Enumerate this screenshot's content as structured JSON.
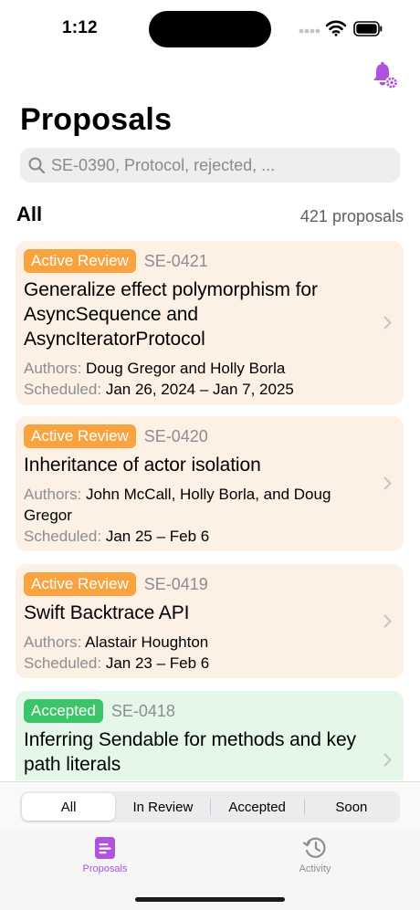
{
  "status": {
    "time": "1:12"
  },
  "header": {
    "title": "Proposals"
  },
  "search": {
    "placeholder": "SE-0390, Protocol, rejected, ..."
  },
  "section": {
    "title": "All",
    "count": "421 proposals"
  },
  "labels": {
    "authors": "Authors:",
    "scheduled": "Scheduled:"
  },
  "proposals": [
    {
      "status": "Active Review",
      "id": "SE-0421",
      "title": "Generalize effect polymorphism for AsyncSequence and AsyncIteratorProtocol",
      "authors": "Doug Gregor and Holly Borla",
      "scheduled": "Jan 26, 2024 – Jan 7, 2025"
    },
    {
      "status": "Active Review",
      "id": "SE-0420",
      "title": "Inheritance of actor isolation",
      "authors": "John McCall, Holly Borla, and Doug Gregor",
      "scheduled": "Jan 25 – Feb 6"
    },
    {
      "status": "Active Review",
      "id": "SE-0419",
      "title": "Swift Backtrace API",
      "authors": "Alastair Houghton",
      "scheduled": "Jan 23 – Feb 6"
    },
    {
      "status": "Accepted",
      "id": "SE-0418",
      "title": "Inferring Sendable for methods and key path literals"
    }
  ],
  "filter": {
    "options": [
      "All",
      "In Review",
      "Accepted",
      "Soon"
    ],
    "selected": "All"
  },
  "tabs": [
    {
      "label": "Proposals",
      "icon": "doc-text-icon",
      "active": true
    },
    {
      "label": "Activity",
      "icon": "clock-history-icon",
      "active": false
    }
  ],
  "colors": {
    "accent": "#af52de",
    "review_badge": "#f9a340",
    "review_card": "#fdf0e4",
    "accepted_badge": "#3cc469",
    "accepted_card": "#e5f7e9"
  }
}
